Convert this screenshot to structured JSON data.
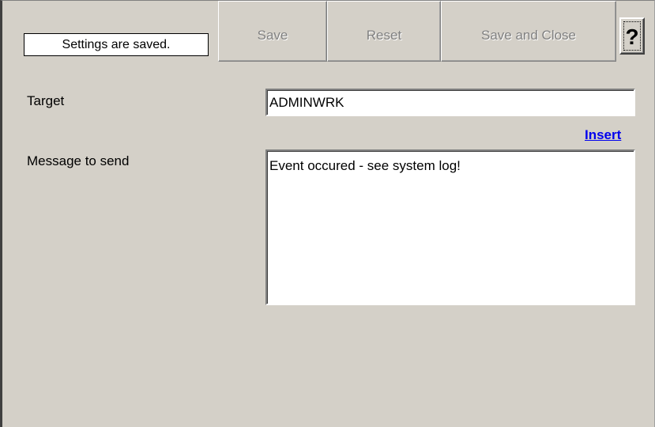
{
  "status": {
    "message": "Settings are saved."
  },
  "toolbar": {
    "save_label": "Save",
    "reset_label": "Reset",
    "save_close_label": "Save and Close",
    "help_label": "?"
  },
  "form": {
    "target": {
      "label": "Target",
      "value": "ADMINWRK"
    },
    "insert_link": "Insert",
    "message": {
      "label": "Message to send",
      "value": "Event occured - see system log!"
    }
  },
  "colors": {
    "background": "#d4d0c8",
    "link": "#0000ee",
    "disabled_text": "#808080"
  },
  "icons": {
    "help": "question-mark-icon"
  }
}
